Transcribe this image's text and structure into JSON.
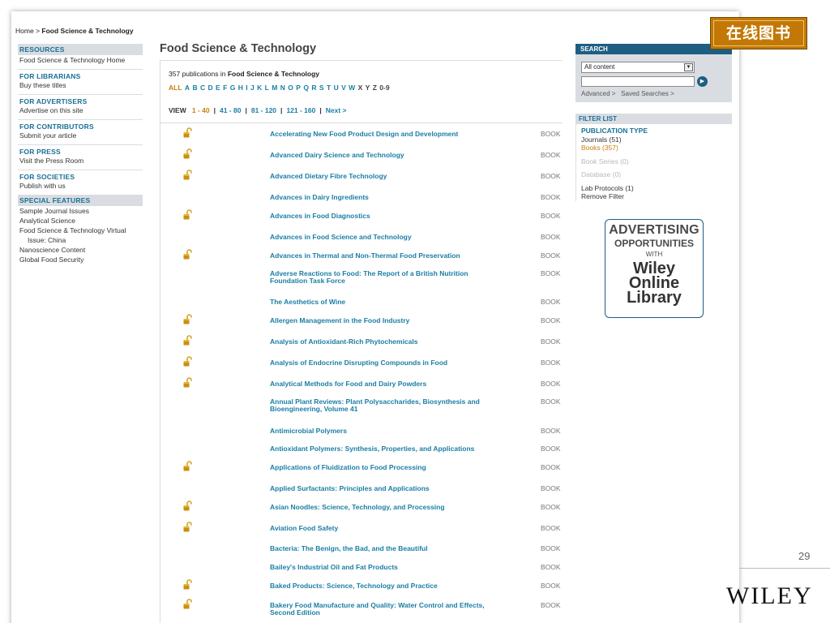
{
  "breadcrumb": {
    "home": "Home",
    "separator": ">",
    "current": "Food Science & Technology"
  },
  "sidebar": {
    "sections": [
      {
        "heading": "RESOURCES",
        "style": "band",
        "links": [
          "Food Science & Technology Home"
        ]
      },
      {
        "heading": "FOR LIBRARIANS",
        "style": "plain",
        "links": [
          "Buy these titles"
        ]
      },
      {
        "heading": "FOR ADVERTISERS",
        "style": "plain",
        "links": [
          "Advertise on this site"
        ]
      },
      {
        "heading": "FOR CONTRIBUTORS",
        "style": "plain",
        "links": [
          "Submit your article"
        ]
      },
      {
        "heading": "FOR PRESS",
        "style": "plain",
        "links": [
          "Visit the Press Room"
        ]
      },
      {
        "heading": "FOR SOCIETIES",
        "style": "plain",
        "links": [
          "Publish with us"
        ]
      },
      {
        "heading": "SPECIAL FEATURES",
        "style": "band",
        "links": [
          "Sample Journal Issues",
          "Analytical Science",
          "Food Science & Technology Virtual",
          "Issue: China",
          "Nanoscience Content",
          "Global Food Security"
        ]
      }
    ]
  },
  "main": {
    "title": "Food Science & Technology",
    "count_number": "357",
    "count_mid": "publications in",
    "count_subject": "Food Science & Technology",
    "alphabet": [
      "ALL",
      "A",
      "B",
      "C",
      "D",
      "E",
      "F",
      "G",
      "H",
      "I",
      "J",
      "K",
      "L",
      "M",
      "N",
      "O",
      "P",
      "Q",
      "R",
      "S",
      "T",
      "U",
      "V",
      "W",
      "X",
      "Y",
      "Z",
      "0-9"
    ],
    "alphabet_active": "ALL",
    "alphabet_dim": [
      "X",
      "Y",
      "Z",
      "0-9"
    ],
    "view_label": "VIEW",
    "pages": [
      "1 - 40",
      "41 - 80",
      "81 - 120",
      "121 - 160",
      "Next >"
    ],
    "pages_current": "1 - 40",
    "publications": [
      {
        "title": "Accelerating New Food Product Design and Development",
        "type": "BOOK",
        "open": true
      },
      {
        "title": "Advanced Dairy Science and Technology",
        "type": "BOOK",
        "open": true
      },
      {
        "title": "Advanced Dietary Fibre Technology",
        "type": "BOOK",
        "open": true
      },
      {
        "title": "Advances in Dairy Ingredients",
        "type": "BOOK",
        "open": false
      },
      {
        "title": "Advances in Food Diagnostics",
        "type": "BOOK",
        "open": true
      },
      {
        "title": "Advances in Food Science and Technology",
        "type": "BOOK",
        "open": false
      },
      {
        "title": "Advances in Thermal and Non-Thermal Food Preservation",
        "type": "BOOK",
        "open": true
      },
      {
        "title": "Adverse Reactions to Food: The Report of a British Nutrition Foundation Task Force",
        "type": "BOOK",
        "open": false
      },
      {
        "title": "The Aesthetics of Wine",
        "type": "BOOK",
        "open": false
      },
      {
        "title": "Allergen Management in the Food Industry",
        "type": "BOOK",
        "open": true
      },
      {
        "title": "Analysis of Antioxidant-Rich Phytochemicals",
        "type": "BOOK",
        "open": true
      },
      {
        "title": "Analysis of Endocrine Disrupting Compounds in Food",
        "type": "BOOK",
        "open": true
      },
      {
        "title": "Analytical Methods for Food and Dairy Powders",
        "type": "BOOK",
        "open": true
      },
      {
        "title": "Annual Plant Reviews: Plant Polysaccharides, Biosynthesis and Bioengineering, Volume 41",
        "type": "BOOK",
        "open": false
      },
      {
        "title": "Antimicrobial Polymers",
        "type": "BOOK",
        "open": false
      },
      {
        "title": "Antioxidant Polymers: Synthesis, Properties, and Applications",
        "type": "BOOK",
        "open": false
      },
      {
        "title": "Applications of Fluidization to Food Processing",
        "type": "BOOK",
        "open": true
      },
      {
        "title": "Applied Surfactants: Principles and Applications",
        "type": "BOOK",
        "open": false
      },
      {
        "title": "Asian Noodles: Science, Technology, and Processing",
        "type": "BOOK",
        "open": true
      },
      {
        "title": "Aviation Food Safety",
        "type": "BOOK",
        "open": true
      },
      {
        "title": "Bacteria: The Benign, the Bad, and the Beautiful",
        "type": "BOOK",
        "open": false
      },
      {
        "title": "Bailey's Industrial Oil and Fat Products",
        "type": "BOOK",
        "open": false
      },
      {
        "title": "Baked Products: Science, Technology and Practice",
        "type": "BOOK",
        "open": true
      },
      {
        "title": "Bakery Food Manufacture and Quality: Water Control and Effects, Second Edition",
        "type": "BOOK",
        "open": true
      }
    ]
  },
  "search": {
    "heading": "SEARCH",
    "scope_value": "All content",
    "advanced_link": "Advanced >",
    "saved_link": "Saved Searches >"
  },
  "filter": {
    "heading": "FILTER LIST",
    "group_heading": "PUBLICATION TYPE",
    "items": [
      {
        "label": "Journals (51)",
        "state": "normal"
      },
      {
        "label": "Books (357)",
        "state": "active"
      },
      {
        "label": "Book Series (0)",
        "state": "dim"
      },
      {
        "label": "Database (0)",
        "state": "dim"
      },
      {
        "label": "Lab Protocols (1)",
        "state": "normal"
      }
    ],
    "remove": "Remove Filter"
  },
  "ad": {
    "line1": "ADVERTISING",
    "line2": "OPPORTUNITIES",
    "line3": "WITH",
    "line4": "Wiley",
    "line5": "Online",
    "line6": "Library"
  },
  "overlay": {
    "badge_text": "在线图书",
    "slide_number": "29",
    "logo_text": "WILEY"
  },
  "colors": {
    "link": "#1a7ea5",
    "active": "#c9800f",
    "header_band": "#d9dde2",
    "search_header": "#1e5e83",
    "badge": "#c37806",
    "lock_icon": "#c9900f"
  }
}
